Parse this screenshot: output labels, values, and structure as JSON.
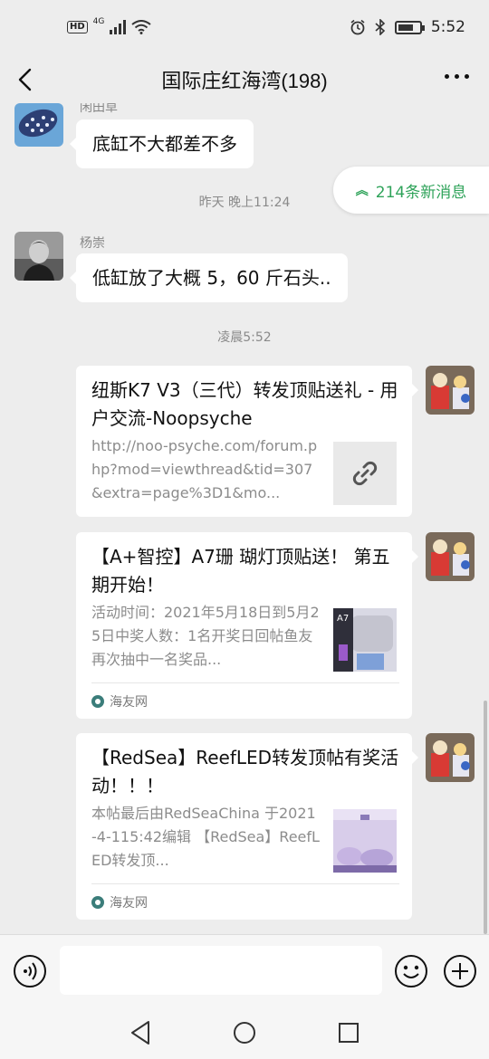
{
  "status_bar": {
    "badge": "HD",
    "network": "4G",
    "time": "5:52"
  },
  "header": {
    "title": "国际庄红海湾(198)"
  },
  "messages": [
    {
      "sender": "闲田草",
      "text": "底缸不大都差不多"
    },
    {
      "sender": "杨崇",
      "text": "低缸放了大概 5，60 斤石头.."
    }
  ],
  "timestamps": [
    "昨天 晚上11:24",
    "凌晨5:52"
  ],
  "new_messages_pill": {
    "label": "214条新消息"
  },
  "cards": [
    {
      "title": "纽斯K7 V3（三代）转发顶贴送礼 - 用户交流-Noopsyche",
      "desc": "http://noo-psyche.com/forum.php?mod=viewthread&tid=307&extra=page%3D1&mo...",
      "thumb": "link-icon",
      "source": ""
    },
    {
      "title": "【A+智控】A7珊 瑚灯顶贴送！ 第五期开始！",
      "desc": "活动时间：2021年5月18日到5月25日中奖人数：1名开奖日回帖鱼友再次抽中一名奖品...",
      "thumb": "A7",
      "source": "海友网"
    },
    {
      "title": "【RedSea】ReefLED转发顶帖有奖活动！！！",
      "desc": "本帖最后由RedSeaChina 于2021-4-115:42编辑 【RedSea】ReefLED转发顶...",
      "thumb": "aquarium-photo",
      "source": "海友网"
    }
  ],
  "input": {
    "placeholder": ""
  },
  "colors": {
    "background": "#ededed",
    "accent_green": "#2fa35a",
    "bubble": "#ffffff",
    "meta_gray": "#8a8a8a"
  }
}
